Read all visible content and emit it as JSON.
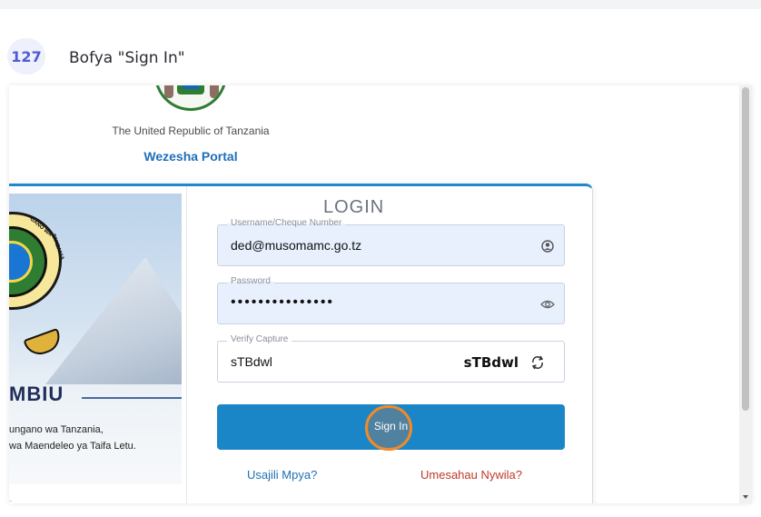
{
  "step": {
    "number": "127",
    "instruction": "Bofya \"Sign In\""
  },
  "header": {
    "republic": "The United Republic of Tanzania",
    "portal": "Wezesha Portal"
  },
  "left_panel": {
    "seal_text_1": "GANO WA",
    "seal_text_2": "TANZANIA",
    "title": "MBIU",
    "line1": "ungano wa Tanzania,",
    "line2": "wa Maendeleo ya Taifa Letu."
  },
  "login": {
    "title": "LOGIN",
    "username": {
      "label": "Username/Cheque Number",
      "value": "ded@musomamc.go.tz"
    },
    "password": {
      "label": "Password",
      "value": "•••••••••••••••"
    },
    "captcha": {
      "label": "Verify Capture",
      "value": "sTBdwl",
      "code": "sTBdwl"
    },
    "signin_label": "Sign In",
    "register_link": "Usajili Mpya?",
    "forgot_link": "Umesahau Nywila?"
  },
  "colors": {
    "accent": "#1a86c7",
    "link": "#1f6fb3",
    "danger_link": "#c0392b",
    "step_badge": "#4f5bd5",
    "click_ring": "#f08a2c"
  },
  "icons": [
    "user-circle-icon",
    "eye-icon",
    "refresh-icon",
    "scroll-down-arrow-icon"
  ]
}
